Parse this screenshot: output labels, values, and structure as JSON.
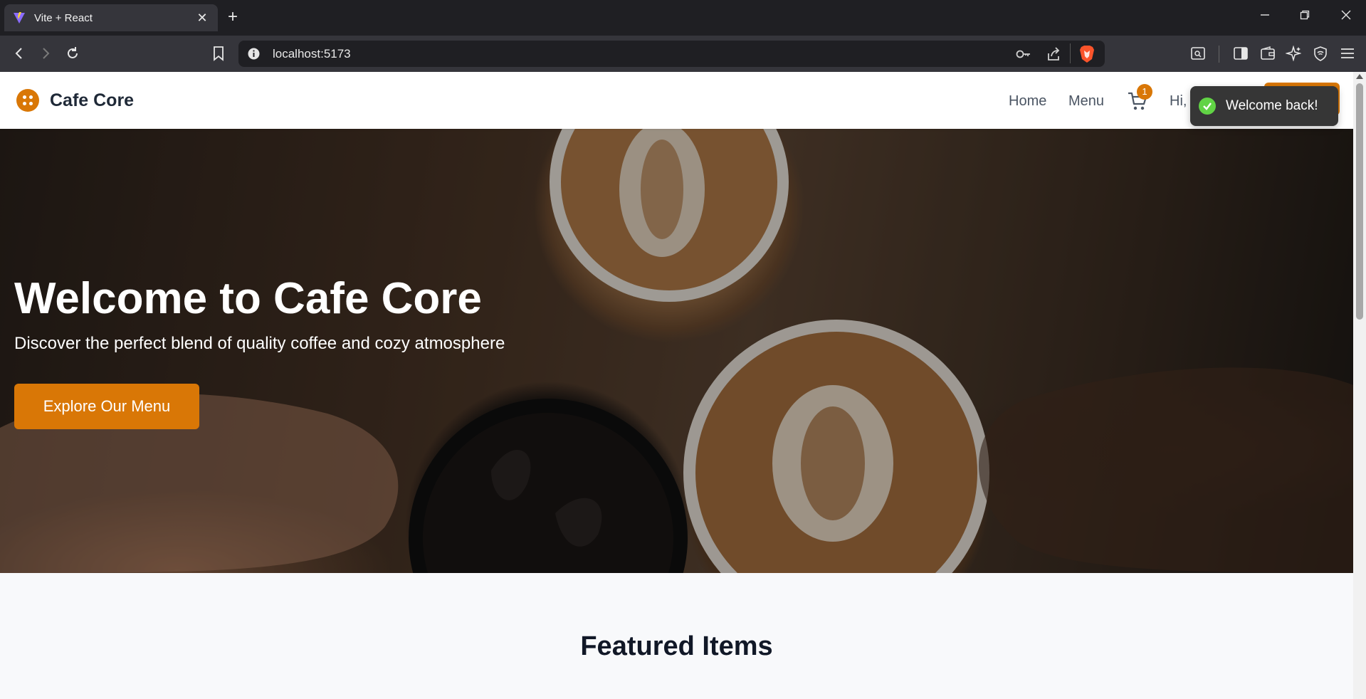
{
  "browser": {
    "tab_title": "Vite + React",
    "url": "localhost:5173",
    "new_tab_symbol": "+",
    "close_tab_symbol": "✕"
  },
  "navbar": {
    "brand": "Cafe Core",
    "links": [
      "Home",
      "Menu"
    ],
    "cart_count": "1",
    "greeting": "Hi,",
    "accent_color": "#d97706"
  },
  "toast": {
    "message": "Welcome back!",
    "icon": "check-circle-icon",
    "color": "#61d345"
  },
  "hero": {
    "title": "Welcome to Cafe Core",
    "subtitle": "Discover the perfect blend of quality coffee and cozy atmosphere",
    "cta_label": "Explore Our Menu"
  },
  "featured": {
    "title": "Featured Items"
  }
}
